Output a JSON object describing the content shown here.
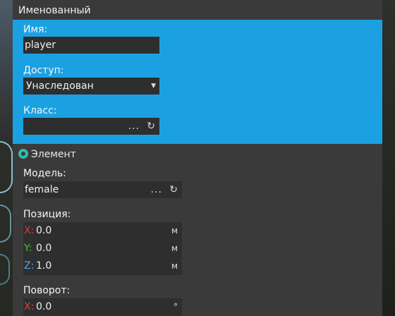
{
  "colors": {
    "accent": "#1ba1e2",
    "panel": "#3a3a3a",
    "field": "#2e2e2e",
    "axis_x": "#e03c3c",
    "axis_y": "#3ec43e",
    "axis_z": "#4ea6ee"
  },
  "named": {
    "title": "Именованный",
    "name_label": "Имя:",
    "name_value": "player",
    "access_label": "Доступ:",
    "access_value": "Унаследован",
    "class_label": "Класс:",
    "class_value": "",
    "dots": "...",
    "reload_icon": "reload-icon"
  },
  "element": {
    "title": "Элемент",
    "icon": "element-icon",
    "model_label": "Модель:",
    "model_value": "female",
    "position_label": "Позиция:",
    "position": [
      {
        "axis": "X:",
        "value": "0.0",
        "unit": "м"
      },
      {
        "axis": "Y:",
        "value": "0.0",
        "unit": "м"
      },
      {
        "axis": "Z:",
        "value": "1.0",
        "unit": "м"
      }
    ],
    "rotation_label": "Поворот:",
    "rotation": [
      {
        "axis": "X:",
        "value": "0.0",
        "unit": "°"
      }
    ]
  }
}
